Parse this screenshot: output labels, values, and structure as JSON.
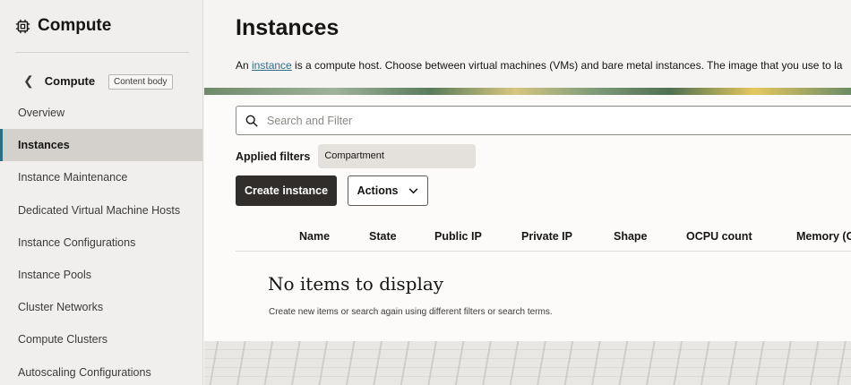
{
  "sidebar": {
    "title": "Compute",
    "back_label": "Compute",
    "tooltip": "Content body",
    "items": [
      {
        "label": "Overview"
      },
      {
        "label": "Instances"
      },
      {
        "label": "Instance Maintenance"
      },
      {
        "label": "Dedicated Virtual Machine Hosts"
      },
      {
        "label": "Instance Configurations"
      },
      {
        "label": "Instance Pools"
      },
      {
        "label": "Cluster Networks"
      },
      {
        "label": "Compute Clusters"
      },
      {
        "label": "Autoscaling Configurations"
      }
    ],
    "active_item": "Instances"
  },
  "main": {
    "title": "Instances",
    "intro_prefix": "An ",
    "intro_link": "instance",
    "intro_suffix": " is a compute host. Choose between virtual machines (VMs) and bare metal instances. The image that you use to la",
    "search_placeholder": "Search and Filter",
    "applied_filters_label": "Applied filters",
    "filter_chip": "Compartment",
    "create_button": "Create instance",
    "actions_button": "Actions",
    "columns": [
      "Name",
      "State",
      "Public IP",
      "Private IP",
      "Shape",
      "OCPU count",
      "Memory (G"
    ],
    "empty_title": "No items to display",
    "empty_subtitle": "Create new items or search again using different filters or search terms."
  },
  "colors": {
    "accent": "#2c6e89",
    "primary_button": "#312d2a",
    "sidebar_bg": "#f1efed",
    "active_item_bg": "#d4d1cc"
  }
}
